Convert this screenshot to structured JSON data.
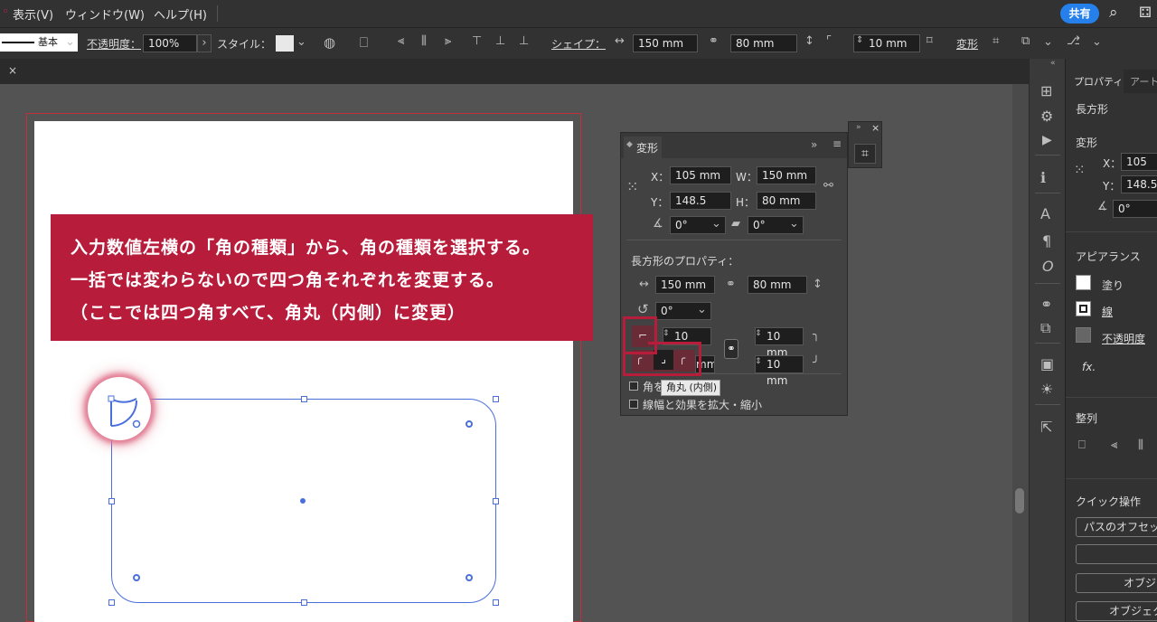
{
  "menubar": {
    "items": [
      "表示(V)",
      "ウィンドウ(W)",
      "ヘルプ(H)"
    ],
    "share_label": "共有"
  },
  "control_bar": {
    "stroke_label": "基本",
    "opacity_label": "不透明度：",
    "opacity_value": "100%",
    "style_label": "スタイル：",
    "shape_label": "シェイプ：",
    "width_value": "150 mm",
    "height_value": "80 mm",
    "corner_value": "10 mm",
    "transform_label": "変形"
  },
  "banner": {
    "line1": "入力数値左横の「角の種類」から、角の種類を選択する。",
    "line2": "一括では変わらないので四つ角それぞれを変更する。",
    "line3": "（ここでは四つ角すべて、角丸（内側）に変更）"
  },
  "transform_panel": {
    "title": "変形",
    "x_label": "X：",
    "x_value": "105 mm",
    "y_label": "Y：",
    "y_value": "148.5 mm",
    "w_label": "W：",
    "w_value": "150 mm",
    "h_label": "H：",
    "h_value": "80 mm",
    "angle_value": "0°",
    "shear_value": "0°",
    "rect_props_label": "長方形のプロパティ：",
    "rect_w": "150 mm",
    "rect_h": "80 mm",
    "rotate_value": "0°",
    "corner_tl": "10 mm",
    "corner_tr": "10 mm",
    "corner_bl": "mm",
    "corner_br": "10 mm",
    "checkbox1": "角を",
    "checkbox2": "線幅と効果を拡大・縮小",
    "tooltip": "角丸 (内側)"
  },
  "properties_panel": {
    "tab1": "プロパティ",
    "tab2": "アート",
    "object_type": "長方形",
    "transform_heading": "変形",
    "x_label": "X：",
    "x_value": "105 m",
    "y_label": "Y：",
    "y_value": "148.5",
    "angle_value": "0°",
    "appearance_heading": "アピアランス",
    "fill_label": "塗り",
    "stroke_label": "線",
    "opacity_label": "不透明度",
    "fx_label": "fx.",
    "align_heading": "整列",
    "quick_heading": "クイック操作",
    "quick_btn1": "パスのオフセッ",
    "quick_btn3": "オブジ",
    "quick_btn4": "オブジェク"
  },
  "colors": {
    "accent": "#b71c3b",
    "selection": "#4a6fdc",
    "share": "#2680eb"
  }
}
